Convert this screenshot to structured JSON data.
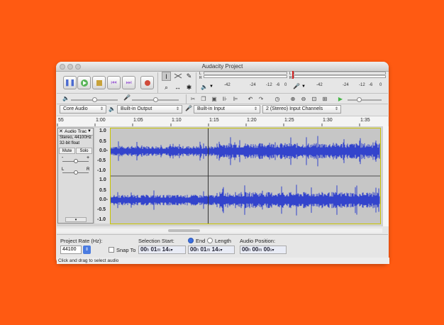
{
  "window": {
    "title": "Audacity Project"
  },
  "meters": {
    "rec_scale": [
      "-42",
      "-24",
      "-12",
      "-6",
      "0"
    ],
    "play_scale": [
      "-42",
      "-24",
      "-12",
      "-6",
      "0"
    ],
    "l": "L",
    "r": "R"
  },
  "devices": {
    "host": "Core Audio",
    "output": "Built-in Output",
    "input": "Built-in Input",
    "channels": "2 (Stereo) Input Channels"
  },
  "ruler": {
    "ticks": [
      "55",
      "1:00",
      "1:05",
      "1:10",
      "1:15",
      "1:20",
      "1:25",
      "1:30",
      "1:35"
    ]
  },
  "track": {
    "name": "Audio Trac",
    "info1": "Stereo, 44100Hz",
    "info2": "32-bit float",
    "mute": "Mute",
    "solo": "Solo",
    "gain_min": "-",
    "gain_max": "+",
    "pan_l": "L",
    "pan_r": "R",
    "yaxis": [
      "1.0",
      "0.5",
      "0.0-",
      "-0.5",
      "-1.0",
      "1.0",
      "0.5",
      "0.0-",
      "-0.5",
      "-1.0"
    ]
  },
  "selection": {
    "rate_label": "Project Rate (Hz):",
    "rate_value": "44100",
    "snap_label": "Snap To",
    "sel_start_label": "Selection Start:",
    "end_label": "End",
    "length_label": "Length",
    "audio_pos_label": "Audio Position:",
    "start_h": "00",
    "start_m": "01",
    "start_s": "14",
    "end_h": "00",
    "end_m": "01",
    "end_s": "14",
    "pos_h": "00",
    "pos_m": "00",
    "pos_s": "00",
    "h": "h",
    "m": "m",
    "s": "s"
  },
  "status": {
    "text": "Click and drag to select audio"
  },
  "colors": {
    "background": "#ff5a12",
    "waveform": "#3344cc",
    "track_bg": "#c7c7c7"
  }
}
